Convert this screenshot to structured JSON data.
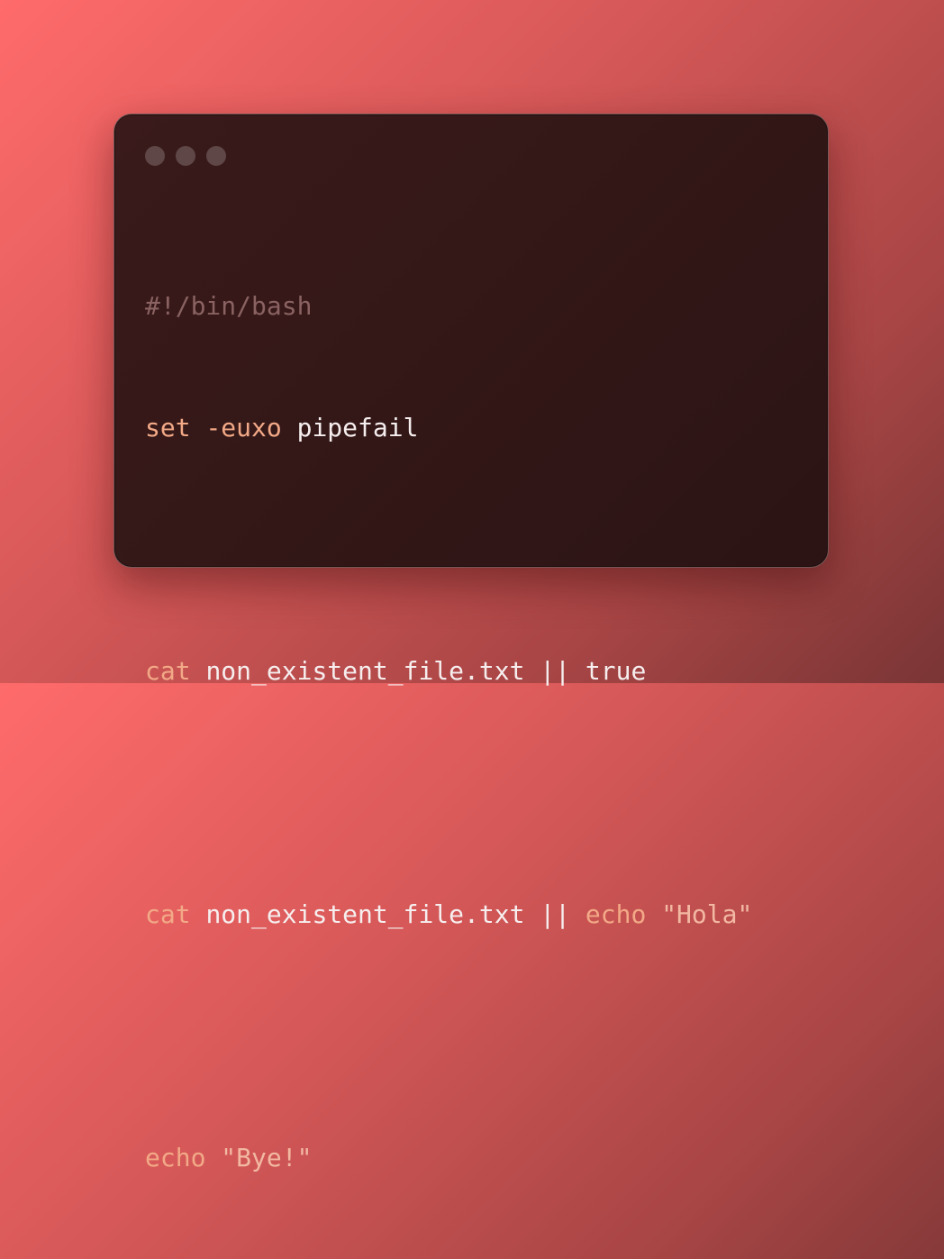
{
  "window": {
    "traffic_lights": [
      "close-dot",
      "minimize-dot",
      "maximize-dot"
    ]
  },
  "code": {
    "line1": {
      "comment": "#!/bin/bash"
    },
    "line2": {
      "cmd": "set",
      "flag": "-euxo",
      "arg": "pipefail"
    },
    "line4": {
      "cmd": "cat",
      "arg": "non_existent_file.txt",
      "op": "||",
      "fallback": "true"
    },
    "line6": {
      "cmd": "cat",
      "arg": "non_existent_file.txt",
      "op": "||",
      "fallback_cmd": "echo",
      "fallback_arg": "\"Hola\""
    },
    "line8": {
      "cmd": "echo",
      "arg": "\"Bye!\""
    }
  },
  "colors": {
    "background_start": "#ff6b6b",
    "background_end": "#7a3535",
    "window_bg": "#2c1414",
    "comment": "#8a6262",
    "keyword": "#f2a987",
    "text": "#f6eeee"
  }
}
